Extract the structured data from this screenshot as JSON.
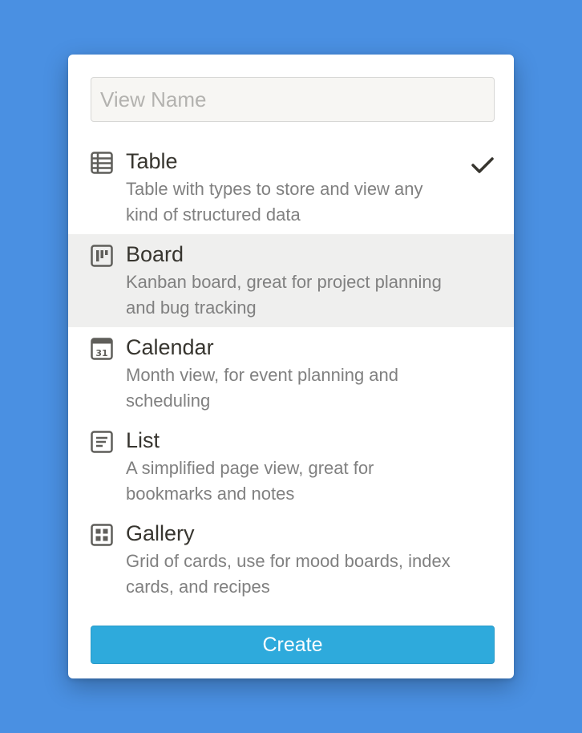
{
  "dialog": {
    "name_input": {
      "value": "",
      "placeholder": "View Name"
    },
    "options": [
      {
        "title": "Table",
        "description": "Table with types to store and view any kind of structured data",
        "icon": "table-icon",
        "selected": true,
        "hovered": false
      },
      {
        "title": "Board",
        "description": "Kanban board, great for project planning and bug tracking",
        "icon": "board-icon",
        "selected": false,
        "hovered": true
      },
      {
        "title": "Calendar",
        "description": "Month view, for event planning and scheduling",
        "icon": "calendar-icon",
        "icon_text": "31",
        "selected": false,
        "hovered": false
      },
      {
        "title": "List",
        "description": "A simplified page view, great for bookmarks and notes",
        "icon": "list-icon",
        "selected": false,
        "hovered": false
      },
      {
        "title": "Gallery",
        "description": "Grid of cards, use for mood boards, index cards, and recipes",
        "icon": "gallery-icon",
        "selected": false,
        "hovered": false
      }
    ],
    "create_label": "Create"
  },
  "colors": {
    "background": "#4a90e2",
    "accent": "#2eaadc",
    "hover": "#efefee",
    "text": "#37352f",
    "muted_text": "#808080"
  }
}
